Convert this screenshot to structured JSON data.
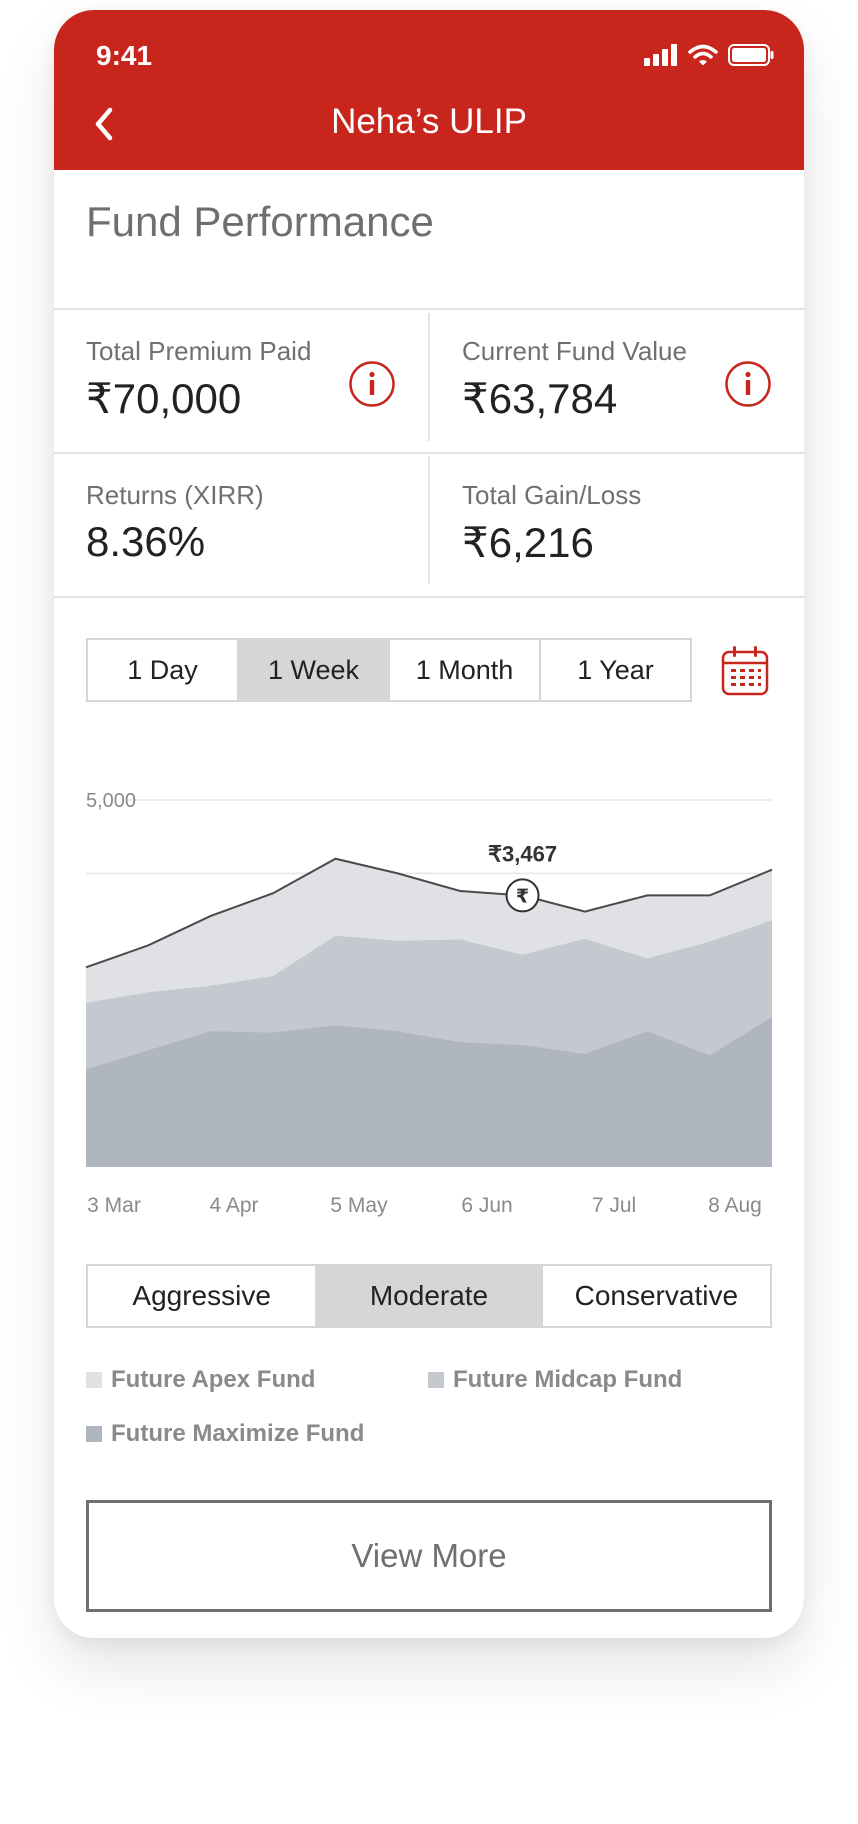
{
  "status_bar": {
    "time": "9:41"
  },
  "header": {
    "title": "Neha’s ULIP"
  },
  "section_title": "Fund Performance",
  "stats": {
    "total_premium_label": "Total Premium Paid",
    "total_premium_value": "₹70,000",
    "current_value_label": "Current Fund Value",
    "current_value_value": "₹63,784",
    "returns_label": "Returns (XIRR)",
    "returns_value": "8.36%",
    "gain_label": "Total Gain/Loss",
    "gain_value": "₹6,216"
  },
  "period_tabs": [
    "1 Day",
    "1 Week",
    "1 Month",
    "1 Year"
  ],
  "period_selected": "1 Week",
  "risk_tabs": [
    "Aggressive",
    "Moderate",
    "Conservative"
  ],
  "risk_selected": "Moderate",
  "view_more_label": "View More",
  "colors": {
    "brand_red": "#c8261d",
    "apex": "#dfe1e5",
    "midcap": "#c4c8cf",
    "maximize": "#b0b6bf",
    "line": "#4a4a4a"
  },
  "chart_data": {
    "type": "area",
    "x": [
      0,
      1,
      2,
      3,
      4,
      5,
      6,
      7,
      8,
      9,
      10,
      11
    ],
    "x_tick_labels": [
      "3 Mar",
      "4 Apr",
      "5 May",
      "6 Jun",
      "7 Jul",
      "8 Aug"
    ],
    "y_tick_labels": [
      "5,000"
    ],
    "ylim": [
      0,
      5000
    ],
    "stacked": true,
    "grid": true,
    "series": [
      {
        "name": "Future Maximize Fund",
        "values": [
          1330,
          1590,
          1850,
          1830,
          1930,
          1850,
          1700,
          1660,
          1540,
          1850,
          1520,
          2040
        ]
      },
      {
        "name": "Future Midcap Fund",
        "values": [
          910,
          790,
          620,
          770,
          1220,
          1230,
          1400,
          1230,
          1570,
          990,
          1550,
          1320
        ]
      },
      {
        "name": "Future Apex Fund",
        "values": [
          480,
          640,
          950,
          1130,
          1050,
          920,
          660,
          810,
          370,
          860,
          630,
          690
        ]
      }
    ],
    "annotation": {
      "label": "₹3,467",
      "index": 7,
      "value": 3700,
      "marker": "₹"
    },
    "legend_position": "bottom"
  }
}
